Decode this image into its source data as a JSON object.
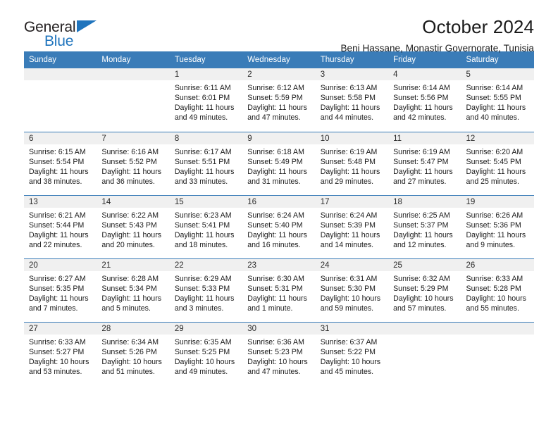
{
  "brand": {
    "name_part1": "General",
    "name_part2": "Blue",
    "triangle_icon": "triangle-icon",
    "accent_color": "#1f74bd"
  },
  "header": {
    "title": "October 2024",
    "subtitle": "Beni Hassane, Monastir Governorate, Tunisia"
  },
  "calendar": {
    "header_bg": "#3a7cb8",
    "daynum_bg": "#f0f0f0",
    "weekdays": [
      "Sunday",
      "Monday",
      "Tuesday",
      "Wednesday",
      "Thursday",
      "Friday",
      "Saturday"
    ],
    "weeks": [
      [
        {
          "day": "",
          "lines": []
        },
        {
          "day": "",
          "lines": []
        },
        {
          "day": "1",
          "lines": [
            "Sunrise: 6:11 AM",
            "Sunset: 6:01 PM",
            "Daylight: 11 hours",
            "and 49 minutes."
          ]
        },
        {
          "day": "2",
          "lines": [
            "Sunrise: 6:12 AM",
            "Sunset: 5:59 PM",
            "Daylight: 11 hours",
            "and 47 minutes."
          ]
        },
        {
          "day": "3",
          "lines": [
            "Sunrise: 6:13 AM",
            "Sunset: 5:58 PM",
            "Daylight: 11 hours",
            "and 44 minutes."
          ]
        },
        {
          "day": "4",
          "lines": [
            "Sunrise: 6:14 AM",
            "Sunset: 5:56 PM",
            "Daylight: 11 hours",
            "and 42 minutes."
          ]
        },
        {
          "day": "5",
          "lines": [
            "Sunrise: 6:14 AM",
            "Sunset: 5:55 PM",
            "Daylight: 11 hours",
            "and 40 minutes."
          ]
        }
      ],
      [
        {
          "day": "6",
          "lines": [
            "Sunrise: 6:15 AM",
            "Sunset: 5:54 PM",
            "Daylight: 11 hours",
            "and 38 minutes."
          ]
        },
        {
          "day": "7",
          "lines": [
            "Sunrise: 6:16 AM",
            "Sunset: 5:52 PM",
            "Daylight: 11 hours",
            "and 36 minutes."
          ]
        },
        {
          "day": "8",
          "lines": [
            "Sunrise: 6:17 AM",
            "Sunset: 5:51 PM",
            "Daylight: 11 hours",
            "and 33 minutes."
          ]
        },
        {
          "day": "9",
          "lines": [
            "Sunrise: 6:18 AM",
            "Sunset: 5:49 PM",
            "Daylight: 11 hours",
            "and 31 minutes."
          ]
        },
        {
          "day": "10",
          "lines": [
            "Sunrise: 6:19 AM",
            "Sunset: 5:48 PM",
            "Daylight: 11 hours",
            "and 29 minutes."
          ]
        },
        {
          "day": "11",
          "lines": [
            "Sunrise: 6:19 AM",
            "Sunset: 5:47 PM",
            "Daylight: 11 hours",
            "and 27 minutes."
          ]
        },
        {
          "day": "12",
          "lines": [
            "Sunrise: 6:20 AM",
            "Sunset: 5:45 PM",
            "Daylight: 11 hours",
            "and 25 minutes."
          ]
        }
      ],
      [
        {
          "day": "13",
          "lines": [
            "Sunrise: 6:21 AM",
            "Sunset: 5:44 PM",
            "Daylight: 11 hours",
            "and 22 minutes."
          ]
        },
        {
          "day": "14",
          "lines": [
            "Sunrise: 6:22 AM",
            "Sunset: 5:43 PM",
            "Daylight: 11 hours",
            "and 20 minutes."
          ]
        },
        {
          "day": "15",
          "lines": [
            "Sunrise: 6:23 AM",
            "Sunset: 5:41 PM",
            "Daylight: 11 hours",
            "and 18 minutes."
          ]
        },
        {
          "day": "16",
          "lines": [
            "Sunrise: 6:24 AM",
            "Sunset: 5:40 PM",
            "Daylight: 11 hours",
            "and 16 minutes."
          ]
        },
        {
          "day": "17",
          "lines": [
            "Sunrise: 6:24 AM",
            "Sunset: 5:39 PM",
            "Daylight: 11 hours",
            "and 14 minutes."
          ]
        },
        {
          "day": "18",
          "lines": [
            "Sunrise: 6:25 AM",
            "Sunset: 5:37 PM",
            "Daylight: 11 hours",
            "and 12 minutes."
          ]
        },
        {
          "day": "19",
          "lines": [
            "Sunrise: 6:26 AM",
            "Sunset: 5:36 PM",
            "Daylight: 11 hours",
            "and 9 minutes."
          ]
        }
      ],
      [
        {
          "day": "20",
          "lines": [
            "Sunrise: 6:27 AM",
            "Sunset: 5:35 PM",
            "Daylight: 11 hours",
            "and 7 minutes."
          ]
        },
        {
          "day": "21",
          "lines": [
            "Sunrise: 6:28 AM",
            "Sunset: 5:34 PM",
            "Daylight: 11 hours",
            "and 5 minutes."
          ]
        },
        {
          "day": "22",
          "lines": [
            "Sunrise: 6:29 AM",
            "Sunset: 5:33 PM",
            "Daylight: 11 hours",
            "and 3 minutes."
          ]
        },
        {
          "day": "23",
          "lines": [
            "Sunrise: 6:30 AM",
            "Sunset: 5:31 PM",
            "Daylight: 11 hours",
            "and 1 minute."
          ]
        },
        {
          "day": "24",
          "lines": [
            "Sunrise: 6:31 AM",
            "Sunset: 5:30 PM",
            "Daylight: 10 hours",
            "and 59 minutes."
          ]
        },
        {
          "day": "25",
          "lines": [
            "Sunrise: 6:32 AM",
            "Sunset: 5:29 PM",
            "Daylight: 10 hours",
            "and 57 minutes."
          ]
        },
        {
          "day": "26",
          "lines": [
            "Sunrise: 6:33 AM",
            "Sunset: 5:28 PM",
            "Daylight: 10 hours",
            "and 55 minutes."
          ]
        }
      ],
      [
        {
          "day": "27",
          "lines": [
            "Sunrise: 6:33 AM",
            "Sunset: 5:27 PM",
            "Daylight: 10 hours",
            "and 53 minutes."
          ]
        },
        {
          "day": "28",
          "lines": [
            "Sunrise: 6:34 AM",
            "Sunset: 5:26 PM",
            "Daylight: 10 hours",
            "and 51 minutes."
          ]
        },
        {
          "day": "29",
          "lines": [
            "Sunrise: 6:35 AM",
            "Sunset: 5:25 PM",
            "Daylight: 10 hours",
            "and 49 minutes."
          ]
        },
        {
          "day": "30",
          "lines": [
            "Sunrise: 6:36 AM",
            "Sunset: 5:23 PM",
            "Daylight: 10 hours",
            "and 47 minutes."
          ]
        },
        {
          "day": "31",
          "lines": [
            "Sunrise: 6:37 AM",
            "Sunset: 5:22 PM",
            "Daylight: 10 hours",
            "and 45 minutes."
          ]
        },
        {
          "day": "",
          "lines": []
        },
        {
          "day": "",
          "lines": []
        }
      ]
    ]
  }
}
